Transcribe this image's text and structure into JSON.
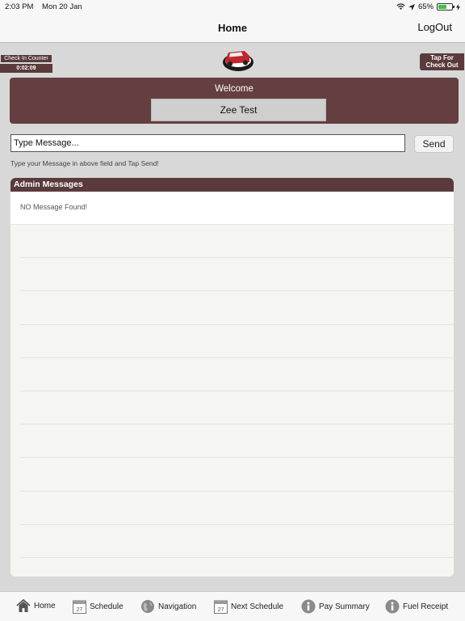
{
  "status_bar": {
    "time": "2:03 PM",
    "date": "Mon 20 Jan",
    "battery": "65%"
  },
  "nav": {
    "title": "Home",
    "logout": "LogOut"
  },
  "checkin": {
    "label": "Check In Counter",
    "time": "0:02:09"
  },
  "checkout": {
    "line1": "Tap For",
    "line2": "Check Out"
  },
  "welcome": {
    "label": "Welcome",
    "user": "Zee Test"
  },
  "message": {
    "placeholder": "Type Message...",
    "send": "Send",
    "hint": "Type your Message in above field and Tap Send!"
  },
  "admin": {
    "title": "Admin Messages",
    "empty": "NO Message Found!"
  },
  "tabs": [
    {
      "label": "Home",
      "icon": "home-icon"
    },
    {
      "label": "Schedule",
      "icon": "calendar-icon"
    },
    {
      "label": "Navigation",
      "icon": "globe-icon"
    },
    {
      "label": "Next Schedule",
      "icon": "calendar-icon"
    },
    {
      "label": "Pay Summary",
      "icon": "info-icon"
    },
    {
      "label": "Fuel Receipt",
      "icon": "info-icon"
    }
  ],
  "calendar_day": "27",
  "colors": {
    "brand": "#5a3a3b",
    "panel": "#653f40"
  }
}
